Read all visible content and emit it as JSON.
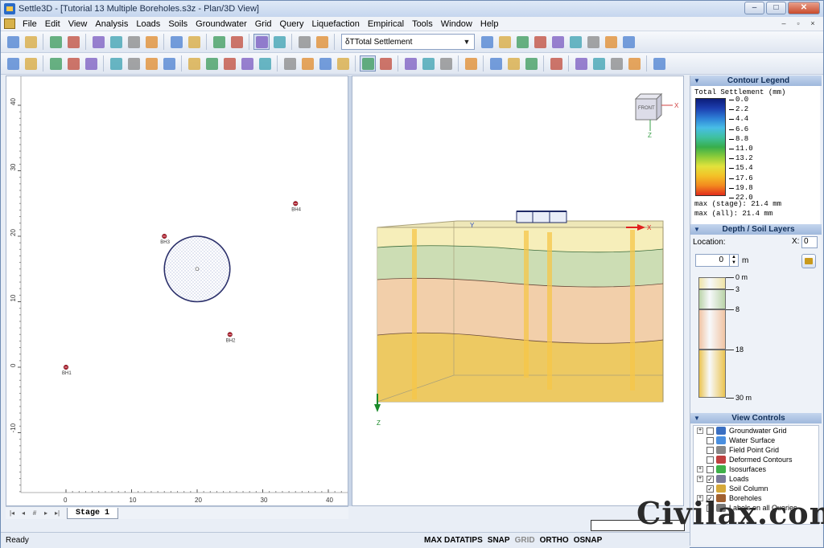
{
  "titlebar": {
    "title": "Settle3D - [Tutorial 13 Multiple Boreholes.s3z - Plan/3D View]",
    "min": "–",
    "max": "□",
    "close": "✕"
  },
  "menu": [
    "File",
    "Edit",
    "View",
    "Analysis",
    "Loads",
    "Soils",
    "Groundwater",
    "Grid",
    "Query",
    "Liquefaction",
    "Empirical",
    "Tools",
    "Window",
    "Help"
  ],
  "mdi": {
    "min": "–",
    "restore": "▫",
    "close": "×"
  },
  "toolbar": {
    "combo_prefix": "δT",
    "combo_value": "Total Settlement",
    "row1_icons": [
      "new-icon",
      "open-icon",
      "save-icon",
      "copy-icon",
      "print-preview-icon",
      "print-icon",
      "color-wheel-icon",
      "export-image-icon",
      "undo-icon",
      "redo-icon",
      "split-view-icon",
      "tools-icon",
      "compute-icon",
      "interpret-icon",
      "play-icon",
      "info-viewer-icon",
      "add-load-icon",
      "circle-load-icon",
      "polygon-load-icon",
      "grid-load-icon",
      "embankment-icon",
      "excavation-icon",
      "layer-icon",
      "query-point-icon",
      "query-line-icon"
    ],
    "row2_icons": [
      "soil-props-icon",
      "assign-props-icon",
      "borehole-add-icon",
      "borehole-edit-icon",
      "borehole-delete-icon",
      "grid-icon",
      "grid-fine-icon",
      "grid-delete-icon",
      "grid-info-icon",
      "select-icon",
      "polyline-icon",
      "time-icon",
      "chart-icon",
      "field-points-icon",
      "zoom-icon",
      "zoom-in-icon",
      "zoom-out-icon",
      "pan-icon",
      "display-mode-icon",
      "render-icon",
      "text-icon",
      "table-icon",
      "arrow-icon",
      "pencil-icon",
      "hexagon-icon",
      "octagon-icon",
      "rectangle-icon",
      "image-icon",
      "angle-icon",
      "angle-red-icon",
      "square-icon",
      "square-red-icon",
      "eraser-icon"
    ]
  },
  "plan": {
    "x_ticks": [
      "0",
      "10",
      "20",
      "30",
      "40"
    ],
    "y_ticks": [
      "40",
      "30",
      "20",
      "10",
      "0",
      "-10"
    ],
    "boreholes": [
      {
        "label": "BH1",
        "x": 0,
        "y": 0
      },
      {
        "label": "BH2",
        "x": 25,
        "y": 5
      },
      {
        "label": "BH3",
        "x": 15,
        "y": 20
      },
      {
        "label": "BH4",
        "x": 35,
        "y": 25
      }
    ],
    "load": {
      "shape": "circle",
      "cx": 20,
      "cy": 15,
      "r": 5
    }
  },
  "view3d": {
    "axis_z": "Z",
    "axis_x": "X",
    "axis_y": "Y",
    "cube_label": "FRONT"
  },
  "legend": {
    "header": "Contour Legend",
    "title": "Total Settlement (mm)",
    "ticks": [
      "0.0",
      "2.2",
      "4.4",
      "6.6",
      "8.8",
      "11.0",
      "13.2",
      "15.4",
      "17.6",
      "19.8",
      "22.0"
    ],
    "max_stage": "max (stage):  21.4 mm",
    "max_all": "max (all):   21.4 mm"
  },
  "depth": {
    "header": "Depth / Soil Layers",
    "location_label": "Location:",
    "x_label": "X:",
    "x_value": "0",
    "depth_value": "0",
    "unit": "m",
    "layers": [
      {
        "top": 0,
        "bottom": 3,
        "color": "#efe3a6"
      },
      {
        "top": 3,
        "bottom": 8,
        "color": "#bad3a8"
      },
      {
        "top": 8,
        "bottom": 18,
        "color": "#f1c4a3"
      },
      {
        "top": 18,
        "bottom": 30,
        "color": "#ebc451"
      }
    ],
    "labels": [
      "0 m",
      "3",
      "8",
      "18",
      "30 m"
    ]
  },
  "view_controls": {
    "header": "View Controls",
    "items": [
      {
        "label": "Groundwater Grid",
        "expand": true,
        "checked": false,
        "color": "#3a6fc2"
      },
      {
        "label": "Water Surface",
        "expand": false,
        "checked": false,
        "color": "#4a8fe0"
      },
      {
        "label": "Field Point Grid",
        "expand": false,
        "checked": false,
        "color": "#888888"
      },
      {
        "label": "Deformed Contours",
        "expand": false,
        "checked": false,
        "color": "#c04040"
      },
      {
        "label": "Isosurfaces",
        "expand": true,
        "checked": false,
        "color": "#3fb04a"
      },
      {
        "label": "Loads",
        "expand": true,
        "checked": true,
        "color": "#7a7a9a"
      },
      {
        "label": "Soil Column",
        "expand": false,
        "checked": true,
        "color": "#d6a93a"
      },
      {
        "label": "Boreholes",
        "expand": true,
        "checked": true,
        "color": "#a06030"
      },
      {
        "label": "Labels on all Queries",
        "expand": false,
        "checked": false,
        "color": "#777777"
      }
    ]
  },
  "stage": {
    "tab": "Stage 1"
  },
  "status": {
    "ready": "Ready",
    "buttons": [
      {
        "label": "MAX DATATIPS",
        "on": true
      },
      {
        "label": "SNAP",
        "on": true
      },
      {
        "label": "GRID",
        "on": false
      },
      {
        "label": "ORTHO",
        "on": true
      },
      {
        "label": "OSNAP",
        "on": true
      }
    ]
  },
  "watermark": "Civilax.com"
}
